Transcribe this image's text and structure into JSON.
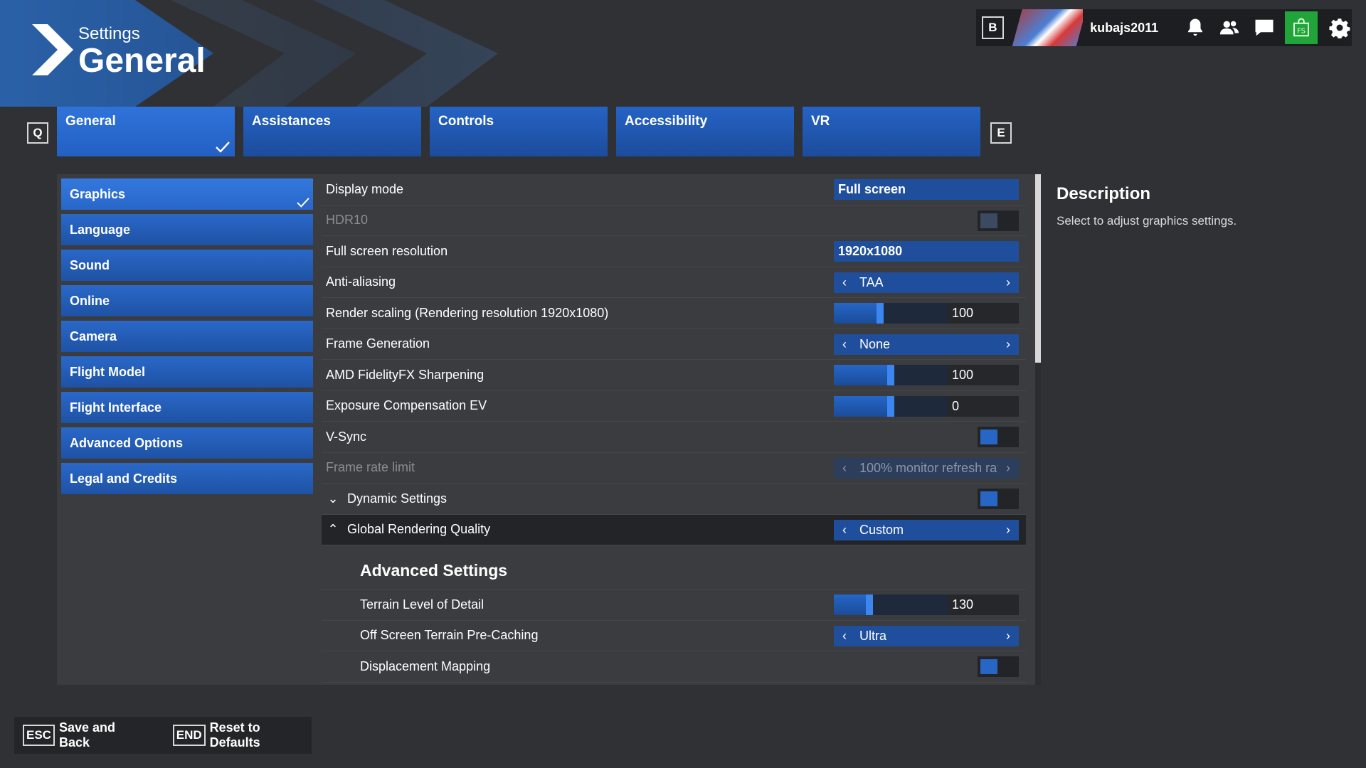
{
  "header": {
    "small_title": "Settings",
    "big_title": "General"
  },
  "userbar": {
    "key": "B",
    "username": "kubajs2011",
    "icons": [
      "bell-icon",
      "friends-icon",
      "chat-icon",
      "store-icon",
      "gear-icon"
    ]
  },
  "tabs": {
    "prev_key": "Q",
    "next_key": "E",
    "items": [
      {
        "label": "General",
        "active": true
      },
      {
        "label": "Assistances"
      },
      {
        "label": "Controls"
      },
      {
        "label": "Accessibility"
      },
      {
        "label": "VR"
      }
    ]
  },
  "sidebar": {
    "items": [
      {
        "label": "Graphics",
        "active": true
      },
      {
        "label": "Language"
      },
      {
        "label": "Sound"
      },
      {
        "label": "Online"
      },
      {
        "label": "Camera"
      },
      {
        "label": "Flight Model"
      },
      {
        "label": "Flight Interface"
      },
      {
        "label": "Advanced Options"
      },
      {
        "label": "Legal and Credits"
      }
    ]
  },
  "settings": {
    "display_mode": {
      "label": "Display mode",
      "value": "Full screen"
    },
    "hdr10": {
      "label": "HDR10"
    },
    "fullscreen_resolution": {
      "label": "Full screen resolution",
      "value": "1920x1080"
    },
    "anti_aliasing": {
      "label": "Anti-aliasing",
      "value": "TAA"
    },
    "render_scaling": {
      "label": "Render scaling (Rendering resolution 1920x1080)",
      "value": "100",
      "level": 0.4
    },
    "frame_generation": {
      "label": "Frame Generation",
      "value": "None"
    },
    "fidelityfx": {
      "label": "AMD FidelityFX Sharpening",
      "value": "100",
      "level": 0.5
    },
    "exposure": {
      "label": "Exposure Compensation EV",
      "value": "0",
      "level": 0.5
    },
    "vsync": {
      "label": "V-Sync"
    },
    "frame_rate_limit": {
      "label": "Frame rate limit",
      "value": "100% monitor refresh rat"
    },
    "dynamic_settings": {
      "label": "Dynamic Settings"
    },
    "global_quality": {
      "label": "Global Rendering Quality",
      "value": "Custom"
    },
    "advanced_title": "Advanced Settings",
    "terrain_lod": {
      "label": "Terrain Level of Detail",
      "value": "130",
      "level": 0.3
    },
    "offscreen_precache": {
      "label": "Off Screen Terrain Pre-Caching",
      "value": "Ultra"
    },
    "displacement_mapping": {
      "label": "Displacement Mapping"
    }
  },
  "description": {
    "title": "Description",
    "text": "Select to adjust graphics settings."
  },
  "footer": {
    "save": {
      "key": "ESC",
      "label": "Save and Back"
    },
    "reset": {
      "key": "END",
      "label": "Reset to Defaults"
    }
  },
  "colors": {
    "accent": "#2563c5",
    "panel": "#3a3c40",
    "background": "#2f3134",
    "store": "#21a53a"
  }
}
